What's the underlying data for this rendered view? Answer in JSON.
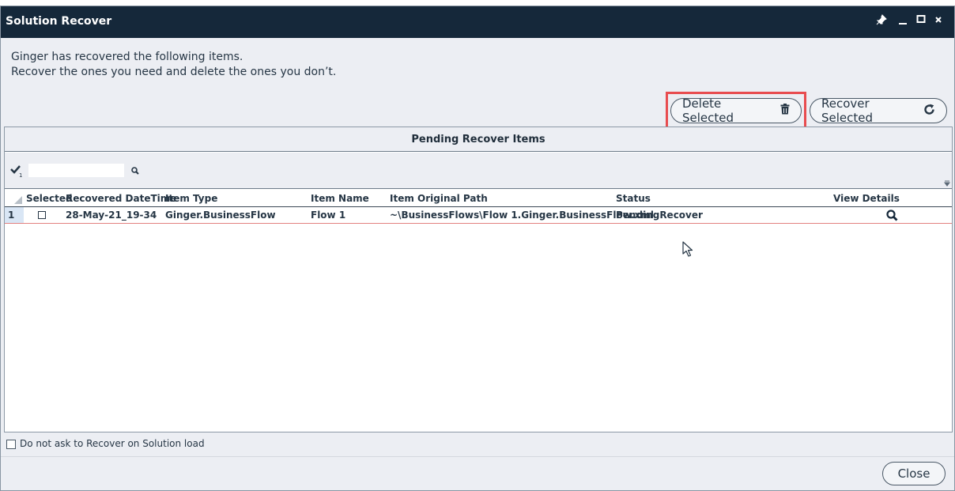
{
  "window": {
    "title": "Solution Recover"
  },
  "intro": {
    "line1": "Ginger has recovered the following items.",
    "line2": "Recover the ones you need and delete the ones you don’t."
  },
  "buttons": {
    "delete_selected": "Delete Selected",
    "recover_selected": "Recover Selected",
    "close": "Close"
  },
  "grid": {
    "title": "Pending Recover Items",
    "search_value": "",
    "columns": [
      "Selected",
      "Recovered DateTime",
      "Item Type",
      "Item Name",
      "Item Original Path",
      "Status",
      "View Details"
    ],
    "rows": [
      {
        "index": "1",
        "selected": false,
        "recovered_datetime": "28-May-21_19-34",
        "item_type": "Ginger.BusinessFlow",
        "item_name": "Flow 1",
        "item_original_path": "~\\BusinessFlows\\Flow 1.Ginger.BusinessFlow.xml",
        "status": "PendingRecover"
      }
    ]
  },
  "footer": {
    "dont_ask_label": "Do not ask to Recover on Solution load",
    "dont_ask_checked": false
  },
  "colors": {
    "titlebar": "#15283a",
    "highlight": "#e84c4f",
    "background": "#eceef3"
  }
}
